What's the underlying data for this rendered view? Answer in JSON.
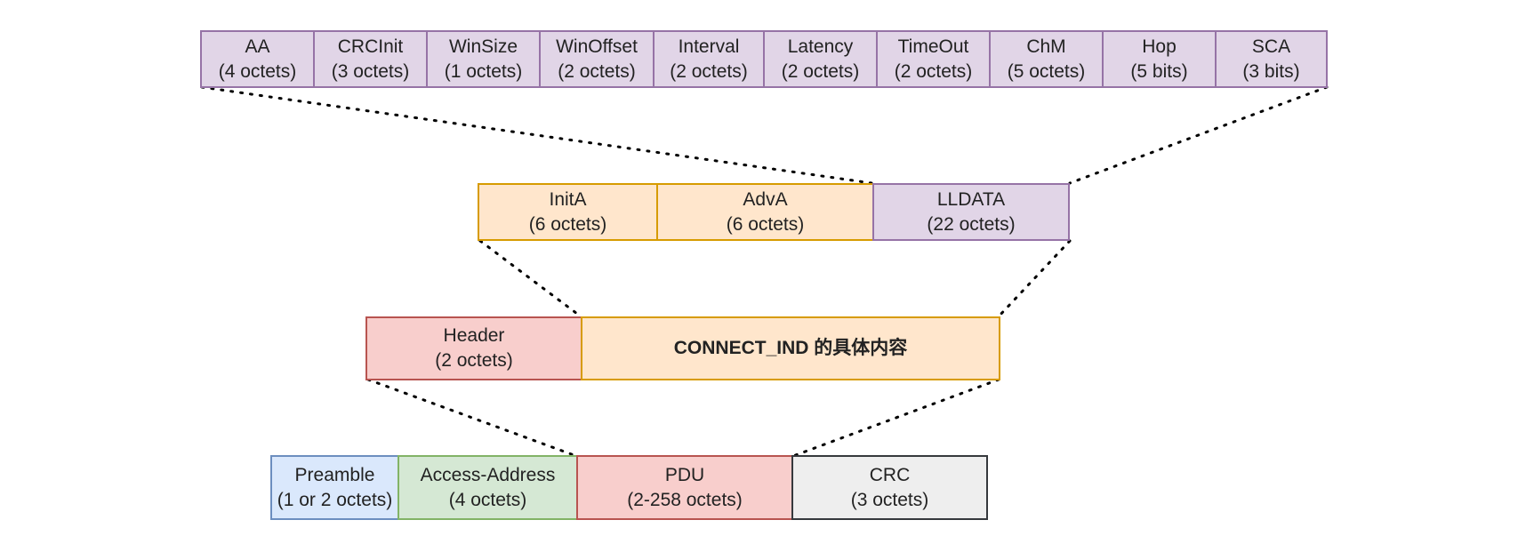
{
  "llcontrol_fields": [
    {
      "name": "AA",
      "size": "(4 octets)"
    },
    {
      "name": "CRCInit",
      "size": "(3 octets)"
    },
    {
      "name": "WinSize",
      "size": "(1 octets)"
    },
    {
      "name": "WinOffset",
      "size": "(2 octets)"
    },
    {
      "name": "Interval",
      "size": "(2 octets)"
    },
    {
      "name": "Latency",
      "size": "(2 octets)"
    },
    {
      "name": "TimeOut",
      "size": "(2 octets)"
    },
    {
      "name": "ChM",
      "size": "(5 octets)"
    },
    {
      "name": "Hop",
      "size": "(5 bits)"
    },
    {
      "name": "SCA",
      "size": "(3 bits)"
    }
  ],
  "payload_fields": [
    {
      "name": "InitA",
      "size": "(6 octets)"
    },
    {
      "name": "AdvA",
      "size": "(6 octets)"
    },
    {
      "name": "LLDATA",
      "size": "(22 octets)"
    }
  ],
  "pdu_fields": [
    {
      "name": "Header",
      "size": "(2 octets)"
    },
    {
      "name": "CONNECT_IND 的具体内容",
      "size": ""
    }
  ],
  "packet_fields": [
    {
      "name": "Preamble",
      "size": "(1 or 2 octets)"
    },
    {
      "name": "Access-Address",
      "size": "(4 octets)"
    },
    {
      "name": "PDU",
      "size": "(2-258 octets)"
    },
    {
      "name": "CRC",
      "size": "(3 octets)"
    }
  ],
  "colors": {
    "purple_fill": "#e1d5e7",
    "purple_stroke": "#9673a6",
    "orange_fill": "#ffe6cc",
    "orange_stroke": "#d79b00",
    "red_fill": "#f8cecc",
    "red_stroke": "#b85450",
    "blue_fill": "#dae8fc",
    "blue_stroke": "#6c8ebf",
    "green_fill": "#d5e8d4",
    "green_stroke": "#82b366",
    "gray_fill": "#eeeeee",
    "gray_stroke": "#36393d"
  }
}
